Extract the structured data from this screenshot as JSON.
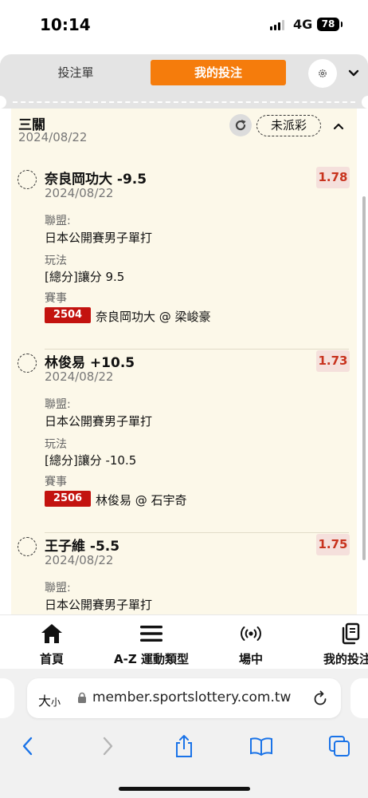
{
  "status_bar": {
    "time": "10:14",
    "network": "4G",
    "battery": "78"
  },
  "tabs": {
    "bet_slip": "投注單",
    "my_bets": "我的投注"
  },
  "combo": {
    "title": "三關",
    "date": "2024/08/22",
    "status": "未派彩"
  },
  "bets": [
    {
      "pick": "奈良岡功大 -9.5",
      "odds": "1.78",
      "date": "2024/08/22",
      "league_label": "聯盟:",
      "league": "日本公開賽男子單打",
      "market_label": "玩法",
      "market": "[總分]讓分 9.5",
      "event_label": "賽事",
      "event_id": "2504",
      "event": "奈良岡功大 @ 梁峻豪"
    },
    {
      "pick": "林俊易 +10.5",
      "odds": "1.73",
      "date": "2024/08/22",
      "league_label": "聯盟:",
      "league": "日本公開賽男子單打",
      "market_label": "玩法",
      "market": "[總分]讓分 -10.5",
      "event_label": "賽事",
      "event_id": "2506",
      "event": "林俊易 @ 石宇奇"
    },
    {
      "pick": "王子維 -5.5",
      "odds": "1.75",
      "date": "2024/08/22",
      "league_label": "聯盟:",
      "league": "日本公開賽男子單打"
    }
  ],
  "bottom_nav": [
    {
      "label": "首頁",
      "icon": "home-icon"
    },
    {
      "label": "A-Z 運動類型",
      "icon": "menu-icon"
    },
    {
      "label": "場中",
      "icon": "live-icon"
    },
    {
      "label": "我的投注",
      "icon": "copy-icon"
    }
  ],
  "browser": {
    "text_size": "大",
    "text_size_small": "小",
    "url": "member.sportslottery.com.tw"
  },
  "colors": {
    "accent": "#f57c0c",
    "odds_text": "#c8331e",
    "event_badge": "#c3130f",
    "content_bg": "#fcf8e9"
  }
}
